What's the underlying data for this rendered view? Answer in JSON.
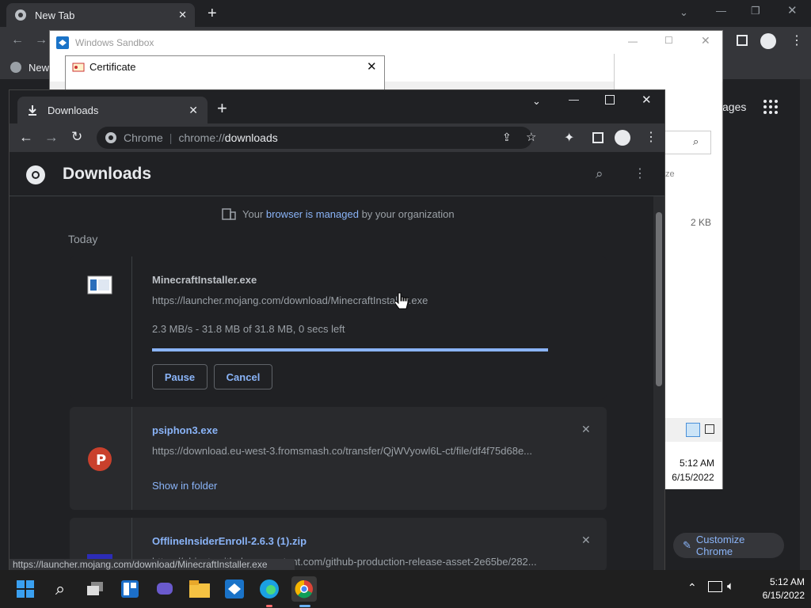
{
  "bg_browser": {
    "tab_title": "New Tab",
    "bookmark_item": "New",
    "right_label": "ages",
    "size_label": "2 KB",
    "customize_label": "Customize Chrome",
    "ze_label": "ze"
  },
  "sandbox": {
    "title": "Windows Sandbox",
    "clock_time": "5:12 AM",
    "clock_date": "6/15/2022"
  },
  "certificate": {
    "title": "Certificate"
  },
  "downloads_window": {
    "tab_title": "Downloads",
    "omnibox_chip": "Chrome",
    "url_prefix": "chrome://",
    "url_page": "downloads",
    "page_title": "Downloads",
    "managed_prefix": "Your ",
    "managed_link": "browser is managed",
    "managed_suffix": " by your organization",
    "date_heading": "Today",
    "items": [
      {
        "name": "MinecraftInstaller.exe",
        "url": "https://launcher.mojang.com/download/MinecraftInstaller.exe",
        "status": "2.3 MB/s - 31.8 MB of 31.8 MB, 0 secs left",
        "progress": 1.0,
        "pause_label": "Pause",
        "cancel_label": "Cancel"
      },
      {
        "name": "psiphon3.exe",
        "url": "https://download.eu-west-3.fromsmash.co/transfer/QjWVyowl6L-ct/file/df4f75d68e...",
        "action_label": "Show in folder"
      },
      {
        "name": "OfflineInsiderEnroll-2.6.3 (1).zip",
        "url": "https://objects.githubusercontent.com/github-production-release-asset-2e65be/282..."
      }
    ],
    "status_bar_url": "https://launcher.mojang.com/download/MinecraftInstaller.exe"
  },
  "taskbar": {
    "time": "5:12 AM",
    "date": "6/15/2022"
  },
  "colors": {
    "accent": "#8ab4f8",
    "page_bg": "#202124",
    "card_bg": "#292a2d",
    "toolbar_bg": "#35363a",
    "progress": "#8ab4f8"
  }
}
